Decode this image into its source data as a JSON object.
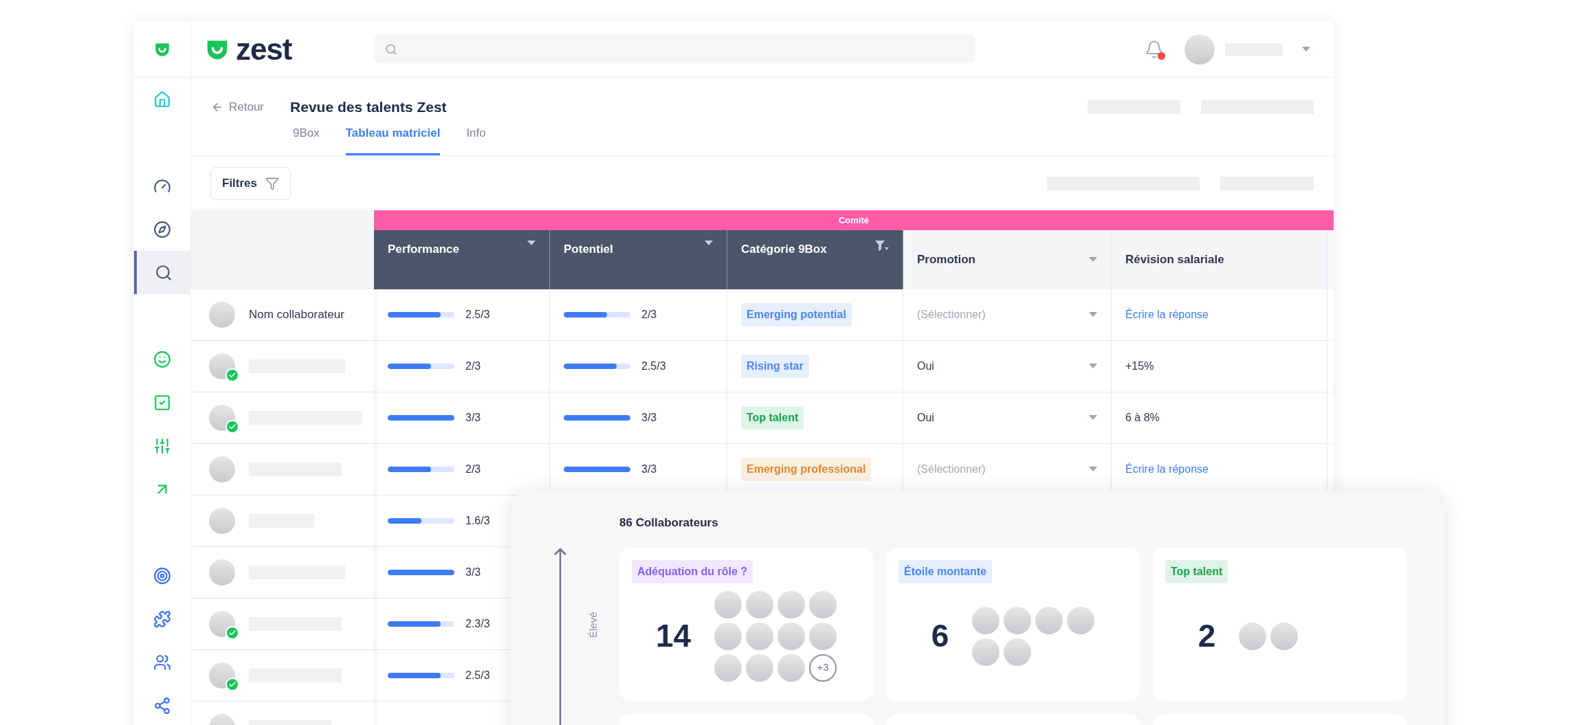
{
  "sidebar": {
    "groups": [
      {
        "items": [
          {
            "kind": "home",
            "selected": false
          }
        ]
      },
      {
        "items": [
          {
            "kind": "gauge",
            "selected": false
          },
          {
            "kind": "compass",
            "selected": false
          },
          {
            "kind": "search-person",
            "selected": true
          }
        ]
      },
      {
        "items": [
          {
            "kind": "smile",
            "selected": false
          },
          {
            "kind": "check",
            "selected": false
          },
          {
            "kind": "sliders",
            "selected": false
          },
          {
            "kind": "arrow",
            "selected": false
          }
        ]
      },
      {
        "items": [
          {
            "kind": "target",
            "selected": false
          },
          {
            "kind": "puzzle",
            "selected": false
          },
          {
            "kind": "users",
            "selected": false
          },
          {
            "kind": "network",
            "selected": false
          }
        ]
      }
    ]
  },
  "header": {
    "logo": "zest",
    "notifications": {
      "unread": true
    }
  },
  "page": {
    "back": "Retour",
    "title": "Revue des talents Zest",
    "tabs": [
      {
        "label": "9Box",
        "selected": false
      },
      {
        "label": "Tableau matriciel",
        "selected": true
      },
      {
        "label": "Info",
        "selected": false
      }
    ]
  },
  "filters_button": "Filtres",
  "table": {
    "group_label": "Comité",
    "columns": [
      {
        "label": "Performance",
        "highlighted": true,
        "filtered": false,
        "dropdown": true
      },
      {
        "label": "Potentiel",
        "highlighted": true,
        "filtered": false,
        "dropdown": true
      },
      {
        "label": "Catégorie 9Box",
        "highlighted": true,
        "filtered": true,
        "dropdown": true
      },
      {
        "label": "Promotion",
        "highlighted": false,
        "filtered": false,
        "dropdown": true
      },
      {
        "label": "Révision salariale",
        "highlighted": false,
        "filtered": false,
        "dropdown": false
      }
    ],
    "rows": [
      {
        "name": "Nom collaborateur",
        "verified": false,
        "performance": {
          "level": 0.79,
          "reading": "2.5/3"
        },
        "potential": {
          "level": 0.65,
          "reading": "2/3"
        },
        "category": {
          "text": "Emerging potential",
          "color": "#4a86f0"
        },
        "promotion": {
          "placeholder": "(Sélectionner)"
        },
        "revision": {
          "kind": "link",
          "text": "Écrire la réponse"
        }
      },
      {
        "verified": true,
        "performance": {
          "level": 0.65,
          "reading": "2/3"
        },
        "potential": {
          "level": 0.79,
          "reading": "2.5/3"
        },
        "category": {
          "text": "Rising star",
          "color": "#4a86f0"
        },
        "promotion": {
          "value": "Oui"
        },
        "revision": {
          "kind": "text",
          "text": "+15%"
        }
      },
      {
        "verified": true,
        "performance": {
          "level": 1,
          "reading": "3/3"
        },
        "potential": {
          "level": 1,
          "reading": "3/3"
        },
        "category": {
          "text": "Top talent",
          "color": "#16a34a"
        },
        "promotion": {
          "value": "Oui"
        },
        "revision": {
          "kind": "text",
          "text": "6 à 8%"
        }
      },
      {
        "verified": false,
        "performance": {
          "level": 0.65,
          "reading": "2/3"
        },
        "potential": {
          "level": 1,
          "reading": "3/3"
        },
        "category": {
          "text": "Emerging professional",
          "color": "#e08a2b"
        },
        "promotion": {
          "placeholder": "(Sélectionner)"
        },
        "revision": {
          "kind": "link",
          "text": "Écrire la réponse"
        }
      },
      {
        "verified": false,
        "performance": {
          "level": 0.5,
          "reading": "1.6/3"
        }
      },
      {
        "verified": false,
        "performance": {
          "level": 1,
          "reading": "3/3"
        }
      },
      {
        "verified": true,
        "performance": {
          "level": 0.79,
          "reading": "2.3/3"
        }
      },
      {
        "verified": true,
        "performance": {
          "level": 0.79,
          "reading": "2.5/3"
        }
      },
      {
        "verified": false
      }
    ]
  },
  "overlay": {
    "title": "86 Collaborateurs",
    "axis_label": "Élevé",
    "cards": [
      {
        "label": "Adéquation du rôle ?",
        "color": "#8b5cf6",
        "count": "14",
        "avatars": [
          {
            "kind": "photo"
          },
          {
            "kind": "photo"
          },
          {
            "kind": "photo"
          },
          {
            "kind": "photo"
          },
          {
            "kind": "photo"
          },
          {
            "kind": "photo"
          },
          {
            "kind": "photo"
          },
          {
            "kind": "photo"
          },
          {
            "kind": "photo"
          },
          {
            "kind": "photo"
          },
          {
            "kind": "photo"
          }
        ],
        "more": "+3"
      },
      {
        "label": "Étoile montante",
        "color": "#4a86f0",
        "count": "6",
        "avatars": [
          {
            "kind": "photo"
          },
          {
            "kind": "photo"
          },
          {
            "kind": "photo"
          },
          {
            "kind": "photo"
          },
          {
            "kind": "photo"
          },
          {
            "kind": "photo"
          }
        ]
      },
      {
        "label": "Top talent",
        "color": "#16a34a",
        "count": "2",
        "avatars": [
          {
            "kind": "photo"
          },
          {
            "kind": "photo"
          }
        ]
      }
    ]
  }
}
